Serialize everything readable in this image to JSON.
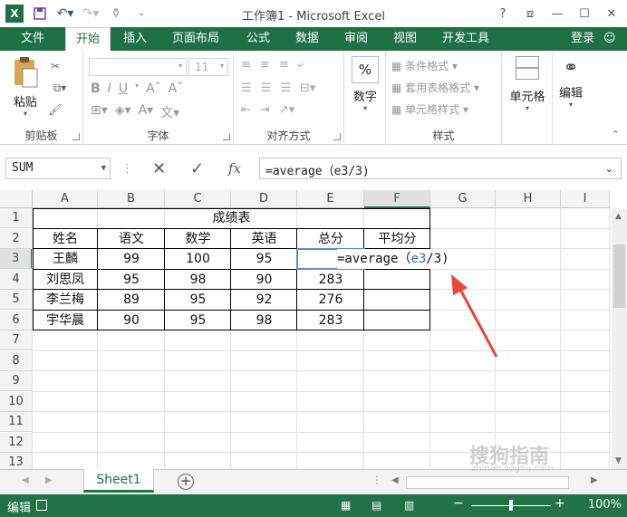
{
  "window": {
    "title": "工作簿1 - Microsoft Excel",
    "controls": [
      "?",
      "⧈",
      "—",
      "☐",
      "✕"
    ]
  },
  "tabs": [
    {
      "label": "文件"
    },
    {
      "label": "开始"
    },
    {
      "label": "插入"
    },
    {
      "label": "页面布局"
    },
    {
      "label": "公式"
    },
    {
      "label": "数据"
    },
    {
      "label": "审阅"
    },
    {
      "label": "视图"
    },
    {
      "label": "开发工具"
    }
  ],
  "active_tab": "开始",
  "login": "登录",
  "ribbon": {
    "clipboard": {
      "label": "剪贴板",
      "paste": "粘贴"
    },
    "font": {
      "label": "字体",
      "size": "11",
      "bold": "B",
      "italic": "I",
      "underline": "U"
    },
    "alignment": {
      "label": "对齐方式"
    },
    "number": {
      "label": "数字",
      "big": "数字",
      "symbol": "%"
    },
    "styles": {
      "label": "样式",
      "conditional": "条件格式",
      "table": "套用表格格式",
      "cell": "单元格样式"
    },
    "cells": {
      "label": "单元格"
    },
    "editing": {
      "label": "编辑"
    }
  },
  "formula_bar": {
    "name_box": "SUM",
    "fx": "fx",
    "formula": "=average（e3/3)"
  },
  "columns": [
    "A",
    "B",
    "C",
    "D",
    "E",
    "F",
    "G",
    "H",
    "I"
  ],
  "rows": [
    "1",
    "2",
    "3",
    "4",
    "5",
    "6",
    "7",
    "8",
    "9",
    "10",
    "11",
    "12",
    "13"
  ],
  "sheet": {
    "title": "成绩表",
    "headers": [
      "姓名",
      "语文",
      "数学",
      "英语",
      "总分",
      "平均分"
    ],
    "data": [
      [
        "王麟",
        "99",
        "100",
        "95",
        ""
      ],
      [
        "刘思凤",
        "95",
        "98",
        "90",
        "283"
      ],
      [
        "李兰梅",
        "89",
        "95",
        "92",
        "276"
      ],
      [
        "宇华晨",
        "90",
        "95",
        "98",
        "283"
      ]
    ],
    "editing": {
      "prefix": "=average（",
      "ref": "e3",
      "suffix": "/3",
      "close": ")"
    }
  },
  "sheet_tabs": [
    {
      "label": "Sheet1"
    }
  ],
  "status": {
    "mode": "编辑",
    "zoom": "100%"
  },
  "watermark": {
    "main": "搜狗指南",
    "sub": "zhinan.sogou.com"
  },
  "colors": {
    "accent": "#217346",
    "annotation": "#e8473b"
  }
}
